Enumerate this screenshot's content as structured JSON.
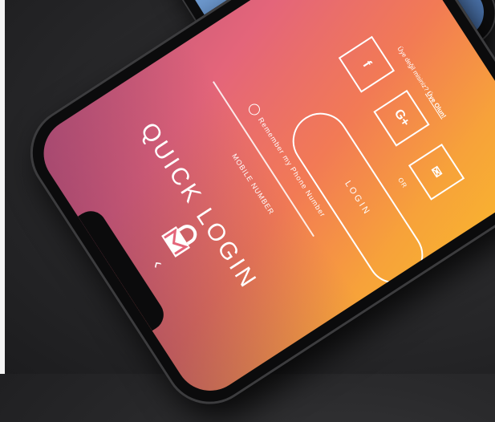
{
  "login": {
    "title": "QUICK LOGIN",
    "mobile_label": "MOBILE NUMBER",
    "remember_label": "Remember my Phone Number",
    "login_button": "LOGIN",
    "or_text": "OR",
    "signup_prompt": "Üye değil misiniz?",
    "signup_link": "Üye Olun!",
    "back_icon": "‹",
    "social": {
      "facebook": "f",
      "google": "G+",
      "mail": "✉"
    }
  },
  "colors": {
    "gradient_start": "#c85a7a",
    "gradient_mid": "#f27a55",
    "gradient_end": "#f8b52e",
    "background": "#2a2a2c"
  }
}
